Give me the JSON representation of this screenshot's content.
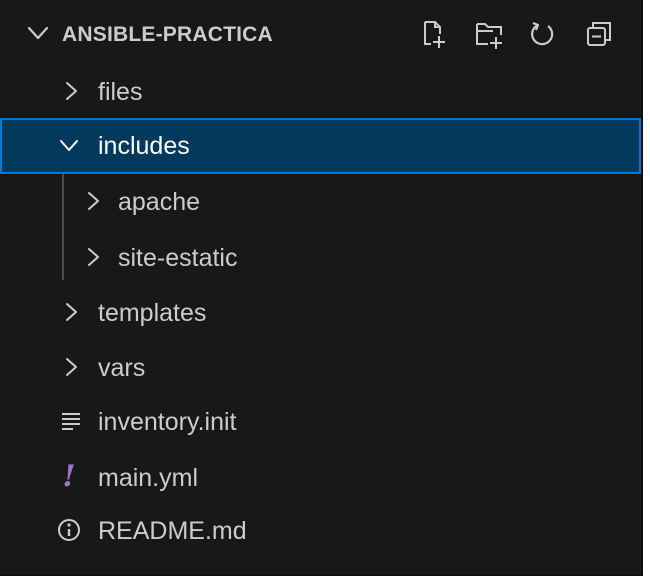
{
  "explorer": {
    "title": "ANSIBLE-PRACTICA",
    "actions": [
      {
        "name": "new-file-icon"
      },
      {
        "name": "new-folder-icon"
      },
      {
        "name": "refresh-icon"
      },
      {
        "name": "collapse-all-icon"
      }
    ],
    "tree": [
      {
        "label": "files",
        "type": "folder",
        "state": "collapsed",
        "depth": 1
      },
      {
        "label": "includes",
        "type": "folder",
        "state": "expanded",
        "depth": 1,
        "selected": true
      },
      {
        "label": "apache",
        "type": "folder",
        "state": "collapsed",
        "depth": 2
      },
      {
        "label": "site-estatic",
        "type": "folder",
        "state": "collapsed",
        "depth": 2
      },
      {
        "label": "templates",
        "type": "folder",
        "state": "collapsed",
        "depth": 1
      },
      {
        "label": "vars",
        "type": "folder",
        "state": "collapsed",
        "depth": 1
      },
      {
        "label": "inventory.init",
        "type": "file",
        "icon": "lines-icon",
        "depth": 1
      },
      {
        "label": "main.yml",
        "type": "file",
        "icon": "yaml-exclamation-icon",
        "depth": 1
      },
      {
        "label": "README.md",
        "type": "file",
        "icon": "info-icon",
        "depth": 1
      }
    ],
    "colors": {
      "background": "#181818",
      "selection_background": "#04395e",
      "selection_border": "#0078d4",
      "text": "#cccccc",
      "yaml_icon": "#a074c4",
      "info_icon": "#519aba"
    }
  }
}
